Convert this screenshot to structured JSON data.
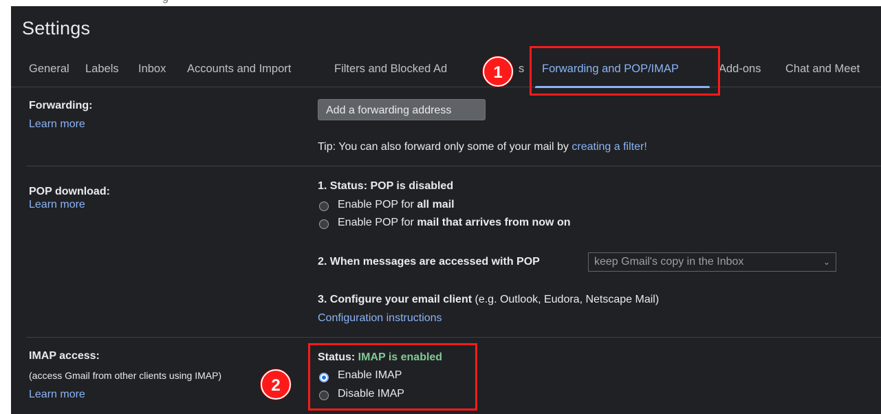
{
  "top_strip_text": "g",
  "settings_title": "Settings",
  "tabs": [
    {
      "label": "General"
    },
    {
      "label": "Labels"
    },
    {
      "label": "Inbox"
    },
    {
      "label": "Accounts and Import"
    },
    {
      "label": "Filters and Blocked Ad"
    },
    {
      "label": "s"
    },
    {
      "label": "Forwarding and POP/IMAP"
    },
    {
      "label": "Add-ons"
    },
    {
      "label": "Chat and Meet"
    }
  ],
  "forwarding": {
    "title": "Forwarding:",
    "learn_more": "Learn more",
    "button": "Add a forwarding address",
    "tip_prefix": "Tip: You can also forward only some of your mail by ",
    "tip_link": "creating a filter!"
  },
  "pop": {
    "title": "POP download:",
    "learn_more": "Learn more",
    "status": "1. Status: POP is disabled",
    "option1_prefix": "Enable POP for ",
    "option1_bold": "all mail",
    "option2_prefix": "Enable POP for ",
    "option2_bold": "mail that arrives from now on",
    "when_accessed": "2. When messages are accessed with POP",
    "select_value": "keep Gmail's copy in the Inbox",
    "configure_bold": "3. Configure your email client",
    "configure_rest": " (e.g. Outlook, Eudora, Netscape Mail)",
    "config_link": "Configuration instructions"
  },
  "imap": {
    "title": "IMAP access:",
    "subtitle": "(access Gmail from other clients using IMAP)",
    "learn_more": "Learn more",
    "status_label": "Status: ",
    "status_value": "IMAP is enabled",
    "enable": "Enable IMAP",
    "disable": "Disable IMAP"
  },
  "annotations": {
    "badge1": "1",
    "badge2": "2",
    "highlight_color": "#ff1a1a"
  },
  "colors": {
    "background": "#202124",
    "link": "#8ab4f8",
    "status_green": "#81c995"
  }
}
